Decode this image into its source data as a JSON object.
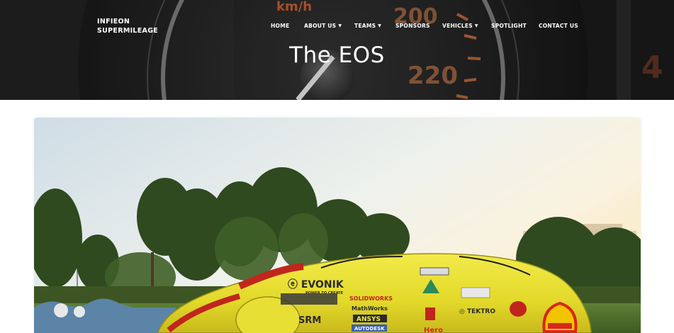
{
  "header": {
    "brand_line1": "INFIEON",
    "brand_line2": "SUPERMILEAGE",
    "nav": [
      {
        "label": "HOME",
        "dropdown": false
      },
      {
        "label": "ABOUT US",
        "dropdown": true
      },
      {
        "label": "TEAMS",
        "dropdown": true
      },
      {
        "label": "SPONSORS",
        "dropdown": false
      },
      {
        "label": "VEHICLES",
        "dropdown": true
      },
      {
        "label": "SPOTLIGHT",
        "dropdown": false
      },
      {
        "label": "CONTACT US",
        "dropdown": false
      }
    ],
    "page_title": "The EOS",
    "speedometer": {
      "unit": "km/h",
      "readings": [
        "200",
        "220"
      ]
    }
  },
  "photo": {
    "subject": "car-photo",
    "sponsors": [
      "EVONIK",
      "POWER TO CREATE",
      "SOLIDWORKS",
      "MathWorks",
      "ANSYS",
      "AUTODESK",
      "SRM",
      "TEKTRO",
      "Hero"
    ]
  },
  "colors": {
    "accent_yellow": "#e6df2a",
    "header_dark": "#1f1f1f",
    "text_white": "#ffffff",
    "shell_red": "#d9261c"
  }
}
